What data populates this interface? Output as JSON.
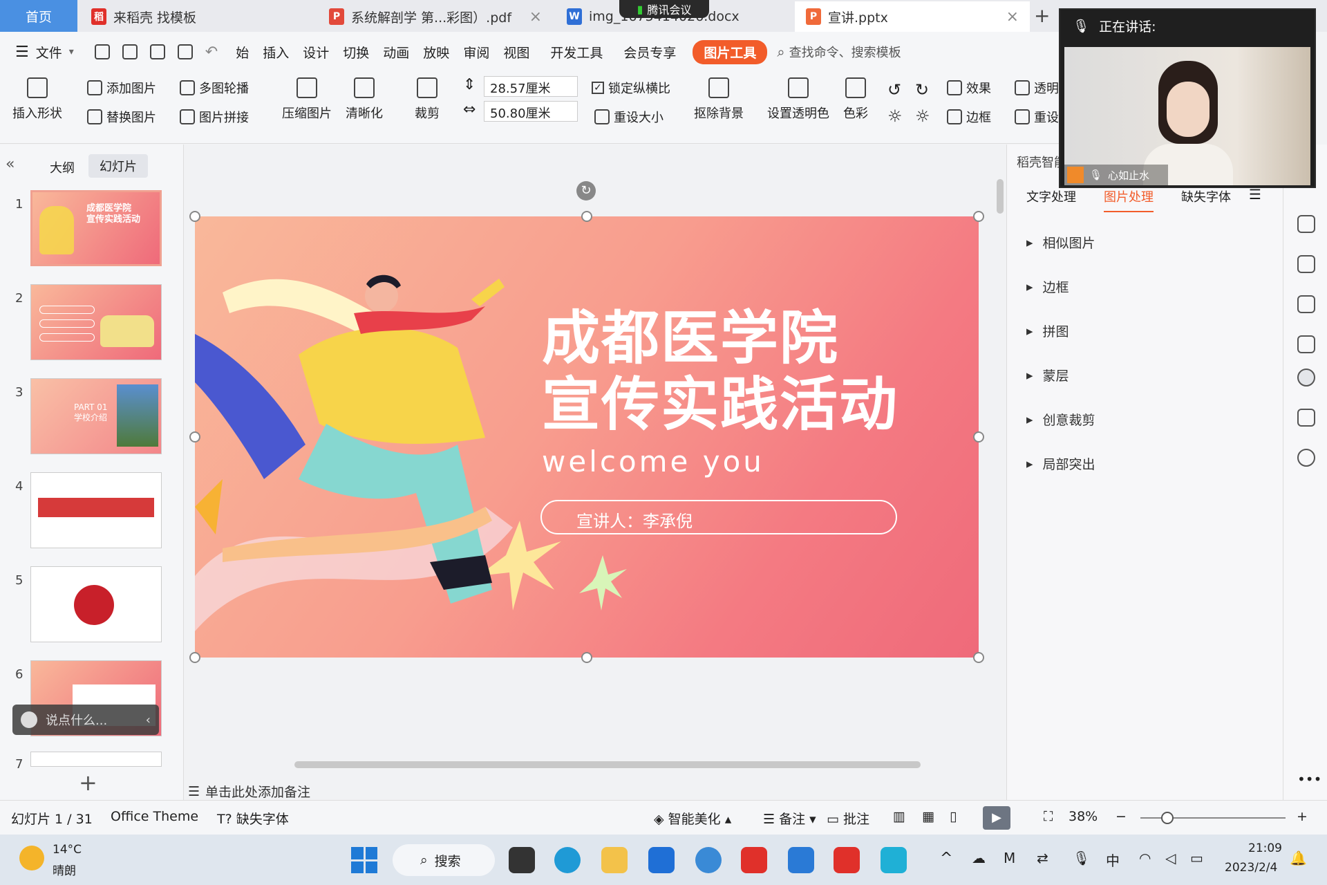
{
  "tabs": {
    "home": "首页",
    "items": [
      {
        "label": "来稻壳 找模板",
        "icon": "稻",
        "color": "#e0302a"
      },
      {
        "label": "系统解剖学 第...彩图）.pdf",
        "icon": "P",
        "color": "#e2493a"
      },
      {
        "label": "img_1675414026.docx",
        "icon": "W",
        "color": "#2f6fd6"
      },
      {
        "label": "宣讲.pptx",
        "icon": "P",
        "color": "#f06a3a"
      }
    ],
    "meeting_label": "腾讯会议",
    "add": "+"
  },
  "menu": {
    "file": "文件",
    "items": [
      "始",
      "插入",
      "设计",
      "切换",
      "动画",
      "放映",
      "审阅",
      "视图",
      "开发工具",
      "会员专享"
    ],
    "picture_tools": "图片工具",
    "search_placeholder": "查找命令、搜索模板"
  },
  "ribbon": {
    "insert_shape": "插入形状",
    "add_picture": "添加图片",
    "replace_picture": "替换图片",
    "multi_carousel": "多图轮播",
    "picture_stitch": "图片拼接",
    "compress": "压缩图片",
    "sharpen": "清晰化",
    "crop": "裁剪",
    "height": "28.57厘米",
    "width": "50.80厘米",
    "lock_ratio": "锁定纵横比",
    "reset_size": "重设大小",
    "remove_bg": "抠除背景",
    "set_transparent": "设置透明色",
    "color": "色彩",
    "effects": "效果",
    "transparency": "透明",
    "border": "边框",
    "reset": "重设"
  },
  "left_panel": {
    "tab_outline": "大纲",
    "tab_slides": "幻灯片",
    "slide_numbers": [
      "1",
      "2",
      "3",
      "4",
      "5",
      "6",
      "7"
    ],
    "thumb1_title": "成都医学院\n宣传实践活动",
    "thumb3_text": "PART 01\n学校介绍",
    "chat_placeholder": "说点什么...",
    "add": "+"
  },
  "slide": {
    "title_line1": "成都医学院",
    "title_line2": "宣传实践活动",
    "subtitle": "welcome you",
    "presenter": "宣讲人：李承倪"
  },
  "notes": {
    "placeholder": "单击此处添加备注"
  },
  "right_panel": {
    "header": "稻壳智能",
    "tabs": [
      "文字处理",
      "图片处理",
      "缺失字体"
    ],
    "active_tab": "图片处理",
    "items": [
      "相似图片",
      "边框",
      "拼图",
      "蒙层",
      "创意裁剪",
      "局部突出"
    ]
  },
  "video": {
    "speaking_label": "正在讲话:",
    "participant": "心如止水"
  },
  "status": {
    "slide_info": "幻灯片 1 / 31",
    "theme": "Office Theme",
    "missing_font": "缺失字体",
    "smart_beautify": "智能美化",
    "notes": "备注",
    "comments": "批注",
    "zoom": "38%"
  },
  "taskbar": {
    "temp": "14°C",
    "weather": "晴朗",
    "search": "搜索",
    "time": "21:09",
    "date": "2023/2/4",
    "ime": "中"
  },
  "colors": {
    "accent": "#f25c2a",
    "home_tab": "#4a90e2",
    "slide_start": "#f9b89a",
    "slide_end": "#ef6a7a"
  }
}
